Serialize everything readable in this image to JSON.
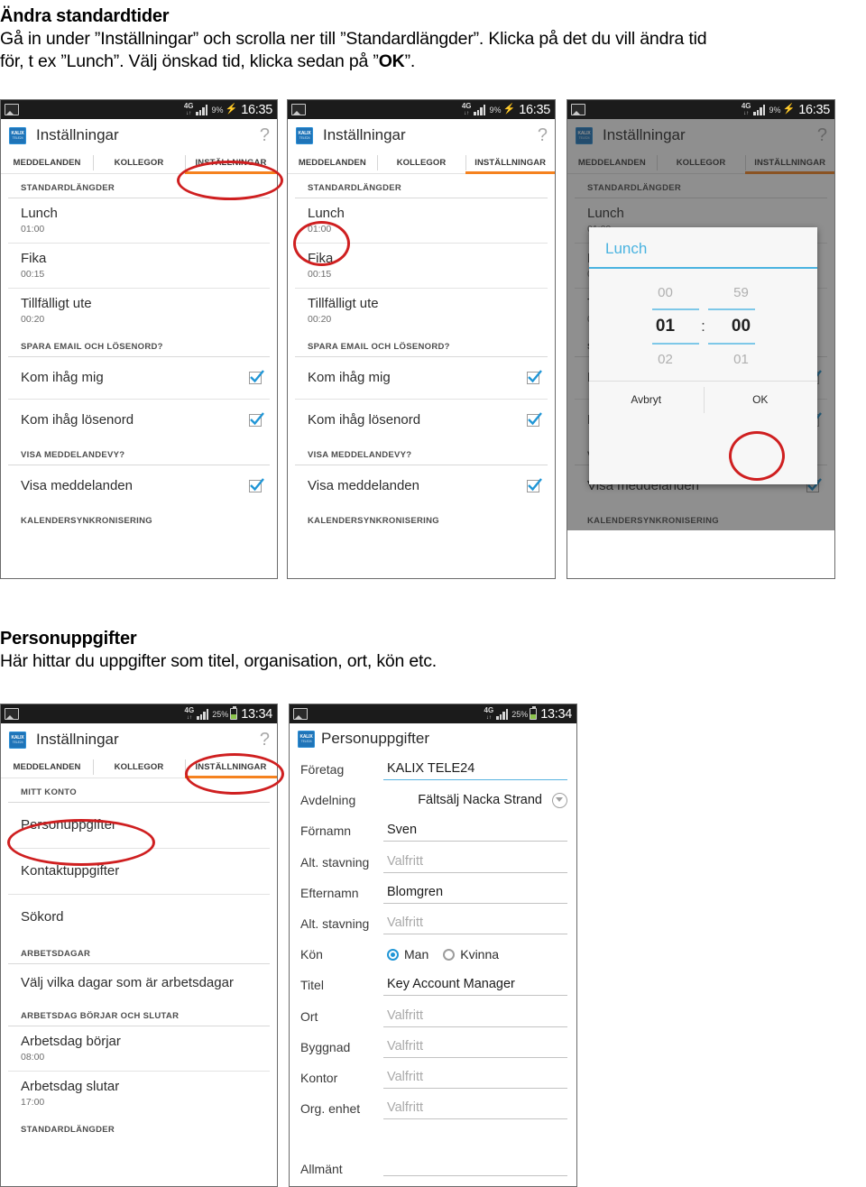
{
  "document": {
    "section1": {
      "heading": "Ändra standardtider",
      "paragraph_line1": "Gå in under ”Inställningar” och scrolla ner till ”Standardlängder”. Klicka på det du vill ändra tid",
      "paragraph_line2_a": "för, t ex ”Lunch”. Välj önskad tid, klicka sedan på ”",
      "paragraph_line2_b": "OK",
      "paragraph_line2_c": "”."
    },
    "section2": {
      "heading": "Personuppgifter",
      "paragraph": "Här hittar du uppgifter som titel, organisation, ort, kön etc."
    }
  },
  "colors": {
    "accent_orange": "#f5821f",
    "annotation_red": "#cf1f20",
    "dialog_blue": "#4ab3e0",
    "logo_blue": "#1f74b8",
    "checkbox_blue": "#2196d6",
    "battery_green": "#8bc34a"
  },
  "statusbar_a": {
    "photo_icon": "image-icon",
    "network": "4G",
    "network_sub": "↓↑",
    "signal_icon": "signal-bars-icon",
    "battery_percent": "9%",
    "charging_icon": "charging-bolt-icon",
    "clock": "16:35"
  },
  "statusbar_b": {
    "photo_icon": "image-icon",
    "network": "4G",
    "network_sub": "↓↑",
    "signal_icon": "signal-bars-icon",
    "battery_percent": "25%",
    "battery_icon": "battery-icon",
    "clock": "13:34"
  },
  "appbar": {
    "logo_line1": "KALIX",
    "logo_line2": "TELE24",
    "title_settings": "Inställningar",
    "title_person": "Personuppgifter",
    "help_icon": "help-question-icon",
    "help_glyph": "?"
  },
  "tabs": [
    {
      "label": "MEDDELANDEN",
      "active": false
    },
    {
      "label": "KOLLEGOR",
      "active": false
    },
    {
      "label": "INSTÄLLNINGAR",
      "active": true
    }
  ],
  "settings_list": {
    "header_standardlangder": "STANDARDLÄNGDER",
    "items": [
      {
        "title": "Lunch",
        "value": "01:00"
      },
      {
        "title": "Fika",
        "value": "00:15"
      },
      {
        "title": "Tillfälligt ute",
        "value": "00:20"
      }
    ],
    "header_spara": "SPARA EMAIL OCH LÖSENORD?",
    "toggles_spara": [
      {
        "label": "Kom ihåg mig",
        "checked": true
      },
      {
        "label": "Kom ihåg lösenord",
        "checked": true
      }
    ],
    "header_visa": "VISA MEDDELANDEVY?",
    "toggles_visa": [
      {
        "label": "Visa meddelanden",
        "checked": true
      }
    ],
    "header_kalender": "KALENDERSYNKRONISERING"
  },
  "time_picker": {
    "title": "Lunch",
    "hours_prev": "00",
    "hours_current": "01",
    "hours_next": "02",
    "minutes_prev": "59",
    "minutes_current": "00",
    "minutes_next": "01",
    "separator": ":",
    "cancel_label": "Avbryt",
    "ok_label": "OK"
  },
  "account_list": {
    "header_mitt_konto": "MITT KONTO",
    "items": [
      {
        "title": "Personuppgifter"
      },
      {
        "title": "Kontaktuppgifter"
      },
      {
        "title": "Sökord"
      }
    ],
    "header_arbetsdagar": "ARBETSDAGAR",
    "arbetsdagar_row": "Välj vilka dagar som är arbetsdagar",
    "header_borjar_slutar": "ARBETSDAG BÖRJAR OCH SLUTAR",
    "time_rows": [
      {
        "title": "Arbetsdag börjar",
        "value": "08:00"
      },
      {
        "title": "Arbetsdag slutar",
        "value": "17:00"
      }
    ],
    "header_standardlangder": "STANDARDLÄNGDER"
  },
  "person_form": {
    "title": "Personuppgifter",
    "fields": [
      {
        "label": "Företag",
        "value": "KALIX TELE24",
        "placeholder": "",
        "style": "accent"
      },
      {
        "label": "Avdelning",
        "value": "Fältsälj Nacka Strand",
        "placeholder": "",
        "style": "dropdown"
      },
      {
        "label": "Förnamn",
        "value": "Sven",
        "placeholder": "",
        "style": "normal"
      },
      {
        "label": "Alt. stavning",
        "value": "",
        "placeholder": "Valfritt",
        "style": "normal"
      },
      {
        "label": "Efternamn",
        "value": "Blomgren",
        "placeholder": "",
        "style": "normal"
      },
      {
        "label": "Alt. stavning",
        "value": "",
        "placeholder": "Valfritt",
        "style": "normal"
      }
    ],
    "gender": {
      "label": "Kön",
      "options": [
        {
          "label": "Man",
          "selected": true
        },
        {
          "label": "Kvinna",
          "selected": false
        }
      ]
    },
    "fields2": [
      {
        "label": "Titel",
        "value": "Key Account Manager",
        "placeholder": "",
        "style": "normal"
      },
      {
        "label": "Ort",
        "value": "",
        "placeholder": "Valfritt",
        "style": "normal"
      },
      {
        "label": "Byggnad",
        "value": "",
        "placeholder": "Valfritt",
        "style": "normal"
      },
      {
        "label": "Kontor",
        "value": "",
        "placeholder": "Valfritt",
        "style": "normal"
      },
      {
        "label": "Org. enhet",
        "value": "",
        "placeholder": "Valfritt",
        "style": "normal"
      }
    ],
    "allmant_label": "Allmänt",
    "allmant_value": ""
  }
}
